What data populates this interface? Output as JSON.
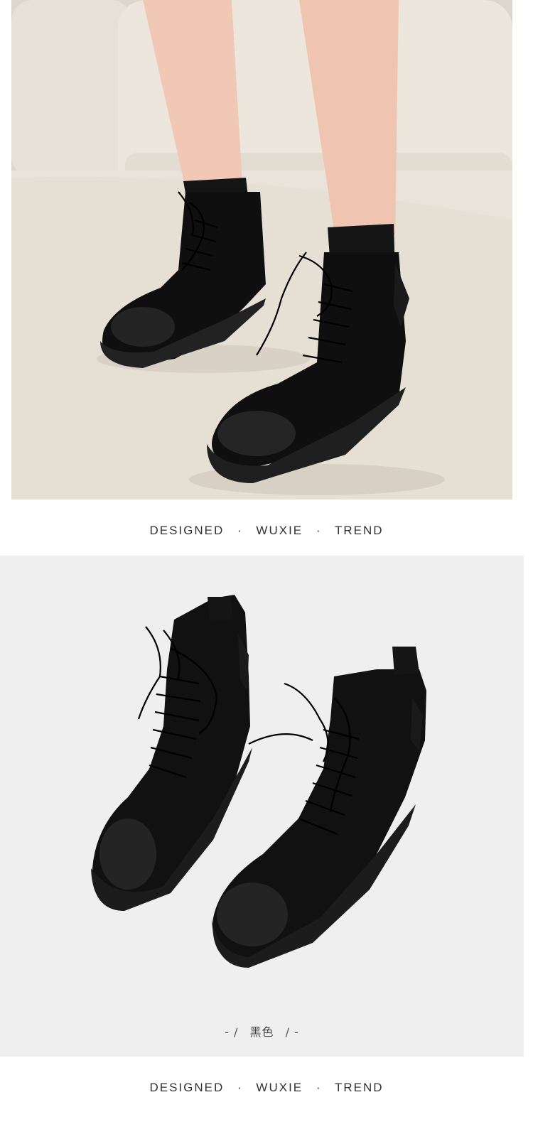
{
  "caption_top": {
    "words": [
      "DESIGNED",
      "WUXIE",
      "TREND"
    ],
    "separator": "·"
  },
  "color_label": {
    "left_deco": "- /",
    "text": "黑色",
    "right_deco": "/ -"
  },
  "caption_bottom": {
    "words": [
      "DESIGNED",
      "WUXIE",
      "TREND"
    ],
    "separator": "·"
  }
}
